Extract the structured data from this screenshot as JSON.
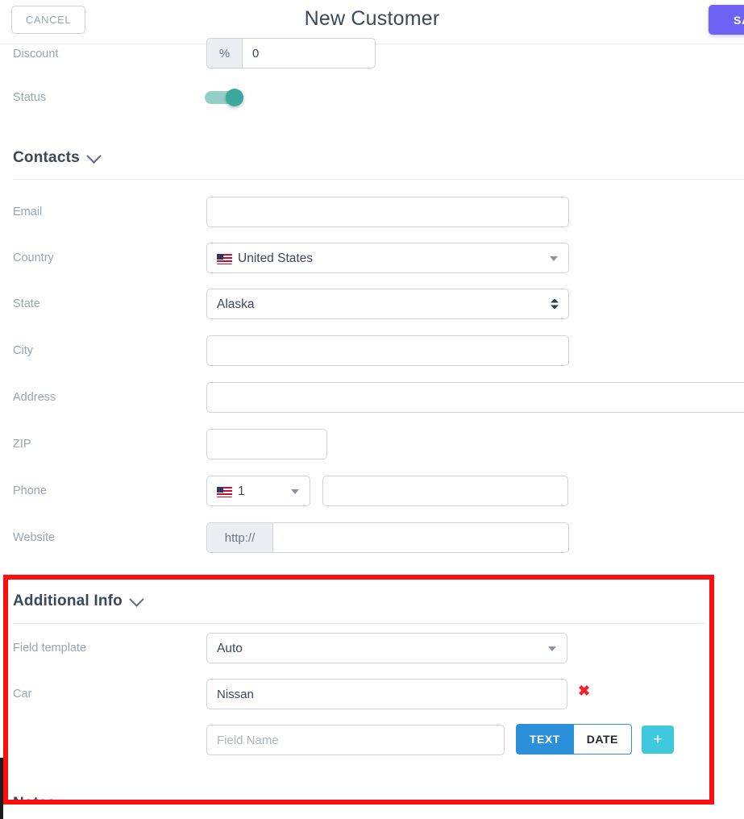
{
  "header": {
    "cancel_label": "CANCEL",
    "title": "New Customer",
    "save_label": "SAVE",
    "save_color": "#6c63f5"
  },
  "top_fields": {
    "discount": {
      "label": "Discount",
      "addon": "%",
      "value": "0"
    },
    "status": {
      "label": "Status",
      "state": "on",
      "track_color": "#92cfc8",
      "knob_color": "#3aa89c"
    }
  },
  "contacts": {
    "title": "Contacts",
    "chevron": "chevron-down-icon",
    "fields": {
      "email": {
        "label": "Email",
        "value": "",
        "placeholder": ""
      },
      "country": {
        "label": "Country",
        "value": "United States",
        "flag": "us-flag-icon"
      },
      "state": {
        "label": "State",
        "value": "Alaska"
      },
      "city": {
        "label": "City",
        "value": "",
        "placeholder": ""
      },
      "address": {
        "label": "Address",
        "value": "",
        "placeholder": ""
      },
      "zip": {
        "label": "ZIP",
        "value": "",
        "placeholder": ""
      },
      "phone": {
        "label": "Phone",
        "code": "1",
        "flag": "us-flag-icon",
        "value": "",
        "placeholder": ""
      },
      "website": {
        "label": "Website",
        "addon": "http://",
        "value": "",
        "placeholder": ""
      }
    }
  },
  "additional_info": {
    "title": "Additional Info",
    "chevron": "chevron-down-icon",
    "highlight_color": "#fd0d0d",
    "field_template": {
      "label": "Field template",
      "value": "Auto"
    },
    "custom_fields": [
      {
        "label": "Car",
        "value": "Nissan",
        "delete_icon": "delete-x-icon"
      }
    ],
    "new_field": {
      "placeholder": "Field Name",
      "value": "",
      "type_options": [
        {
          "label": "TEXT",
          "active": true
        },
        {
          "label": "DATE",
          "active": false
        }
      ],
      "add_label": "+",
      "active_color": "#2b90d9",
      "add_color": "#3fc9dd"
    }
  },
  "next_section": {
    "title": "Notes"
  }
}
